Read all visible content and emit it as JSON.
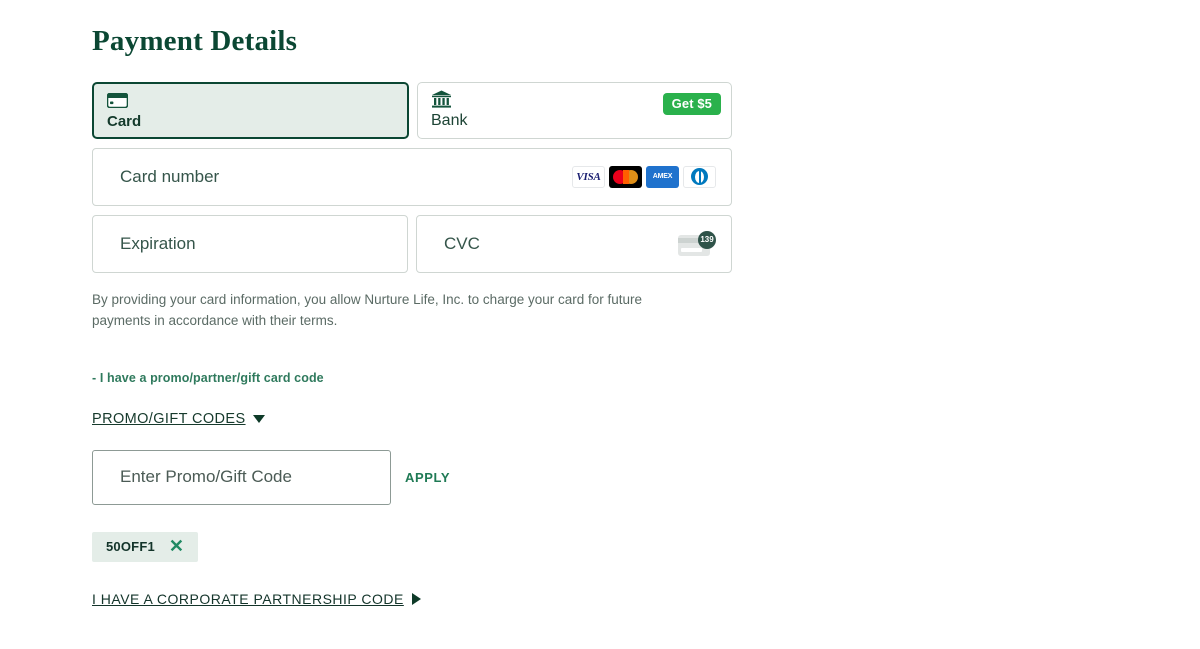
{
  "page": {
    "title": "Payment Details"
  },
  "colors": {
    "brand_green_dark": "#0b4733",
    "brand_green_light_bg": "#e4ede8",
    "badge_green": "#2ab14c",
    "accent_green": "#1f7a55",
    "border_grey": "#cfd6d2"
  },
  "tabs": [
    {
      "id": "card",
      "label": "Card",
      "icon": "credit-card-icon",
      "selected": true,
      "badge": null
    },
    {
      "id": "bank",
      "label": "Bank",
      "icon": "bank-icon",
      "selected": false,
      "badge": "Get $5"
    }
  ],
  "card_form": {
    "card_number": {
      "placeholder": "Card number",
      "value": ""
    },
    "expiration": {
      "placeholder": "Expiration",
      "value": ""
    },
    "cvc": {
      "placeholder": "CVC",
      "value": "",
      "icon": "cvc-card-icon",
      "icon_number": "139"
    },
    "accepted_brands": [
      {
        "name": "visa-icon",
        "label": "VISA"
      },
      {
        "name": "mastercard-icon",
        "label": ""
      },
      {
        "name": "amex-icon",
        "label": "AMEX"
      },
      {
        "name": "diners-club-icon",
        "label": ""
      }
    ],
    "disclaimer": "By providing your card information, you allow Nurture Life, Inc. to charge your card for future payments in accordance with their terms."
  },
  "promo": {
    "note": "- I have a promo/partner/gift card code",
    "toggle_label": "PROMO/GIFT CODES",
    "toggle_icon": "chevron-down-icon",
    "input_placeholder": "Enter Promo/Gift Code",
    "input_value": "",
    "apply_label": "APPLY",
    "applied_codes": [
      {
        "code": "50OFF1",
        "remove_icon": "close-icon"
      }
    ]
  },
  "corporate": {
    "label": "I HAVE A CORPORATE PARTNERSHIP CODE",
    "icon": "chevron-right-icon"
  }
}
